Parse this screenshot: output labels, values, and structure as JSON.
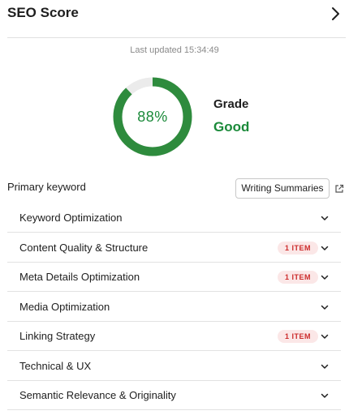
{
  "header": {
    "title": "SEO Score",
    "expand_icon": "chevron-right-icon"
  },
  "last_updated": "Last updated 15:34:49",
  "score": {
    "percent": 88,
    "percent_text": "88%",
    "grade_label": "Grade",
    "grade_value": "Good",
    "ring_color": "#2e8b3d",
    "track_color": "#ebebeb",
    "text_color": "#1b8a3a"
  },
  "keyword": {
    "label": "Primary keyword",
    "button_label": "Writing Summaries",
    "link_icon": "external-link-icon"
  },
  "sections": [
    {
      "label": "Keyword Optimization",
      "badge": ""
    },
    {
      "label": "Content Quality & Structure",
      "badge": "1 ITEM"
    },
    {
      "label": "Meta Details Optimization",
      "badge": "1 ITEM"
    },
    {
      "label": "Media Optimization",
      "badge": ""
    },
    {
      "label": "Linking Strategy",
      "badge": "1 ITEM"
    },
    {
      "label": "Technical & UX",
      "badge": ""
    },
    {
      "label": "Semantic Relevance & Originality",
      "badge": ""
    }
  ],
  "colors": {
    "badge_bg": "#fbe7e7",
    "badge_text": "#cc2b2b"
  }
}
